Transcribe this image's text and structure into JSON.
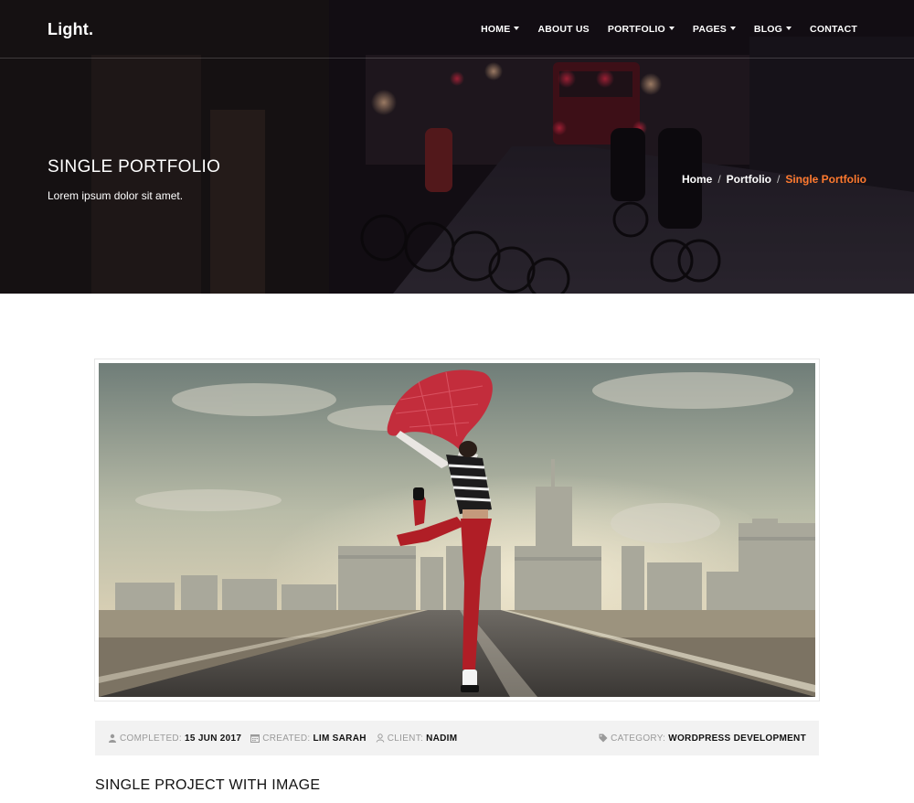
{
  "brand": "Light.",
  "nav": {
    "home": "HOME",
    "about": "ABOUT US",
    "portfolio": "PORTFOLIO",
    "pages": "PAGES",
    "blog": "BLOG",
    "contact": "CONTACT"
  },
  "hero": {
    "title": "SINGLE PORTFOLIO",
    "subtitle": "Lorem ipsum dolor sit amet."
  },
  "breadcrumb": {
    "home": "Home",
    "portfolio": "Portfolio",
    "current": "Single Portfolio"
  },
  "meta": {
    "completed_key": "COMPLETED:",
    "completed_val": "15 JUN 2017",
    "created_key": "CREATED:",
    "created_val": "LIM SARAH",
    "client_key": "CLIENT:",
    "client_val": "NADIM",
    "category_key": "CATEGORY:",
    "category_val": "WORDPRESS DEVELOPMENT"
  },
  "section_title": "SINGLE PROJECT WITH IMAGE",
  "colors": {
    "accent": "#ff7a2f",
    "meta_bg": "#f2f2f2"
  }
}
